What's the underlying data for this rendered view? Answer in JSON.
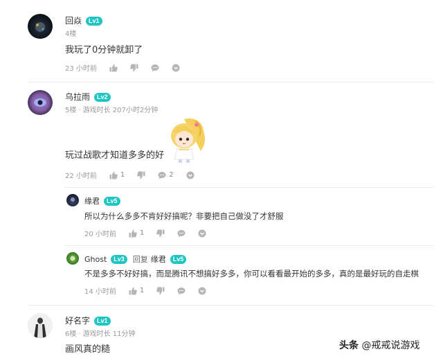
{
  "comments": [
    {
      "username": "回焱",
      "level": "Lv1",
      "floor": "4楼",
      "content": "我玩了0分钟就卸了",
      "time": "23 小时前"
    },
    {
      "username": "乌拉雨",
      "level": "Lv2",
      "floor": "5楼",
      "playtime": "游戏时长 207小时2分钟",
      "content": "玩过战歌才知道多多的好",
      "time": "22 小时前",
      "likes": "1",
      "replies": "2",
      "replies_list": [
        {
          "username": "缘君",
          "level": "Lv5",
          "content": "所以为什么多多不肯好好搞呢？非要把自己做没了才舒服",
          "time": "20 小时前",
          "likes": "1"
        },
        {
          "username": "Ghost",
          "level": "Lv3",
          "reply_word": "回复",
          "reply_to": "缘君",
          "reply_to_level": "Lv5",
          "content": "不是多多不好好搞，而是腾讯不想搞好多多，你可以看看最开始的多多，真的是最好玩的自走棋",
          "time": "14 小时前",
          "likes": "1"
        }
      ]
    },
    {
      "username": "好名字",
      "level": "Lv1",
      "floor": "6楼",
      "playtime": "游戏时长 11分钟",
      "content": "画风真的糙"
    }
  ],
  "watermark": {
    "prefix": "头条",
    "handle": "@戒戒说游戏"
  },
  "colors": {
    "badge": "#1ec5c2",
    "meta": "#999999",
    "divider": "#ececec"
  }
}
